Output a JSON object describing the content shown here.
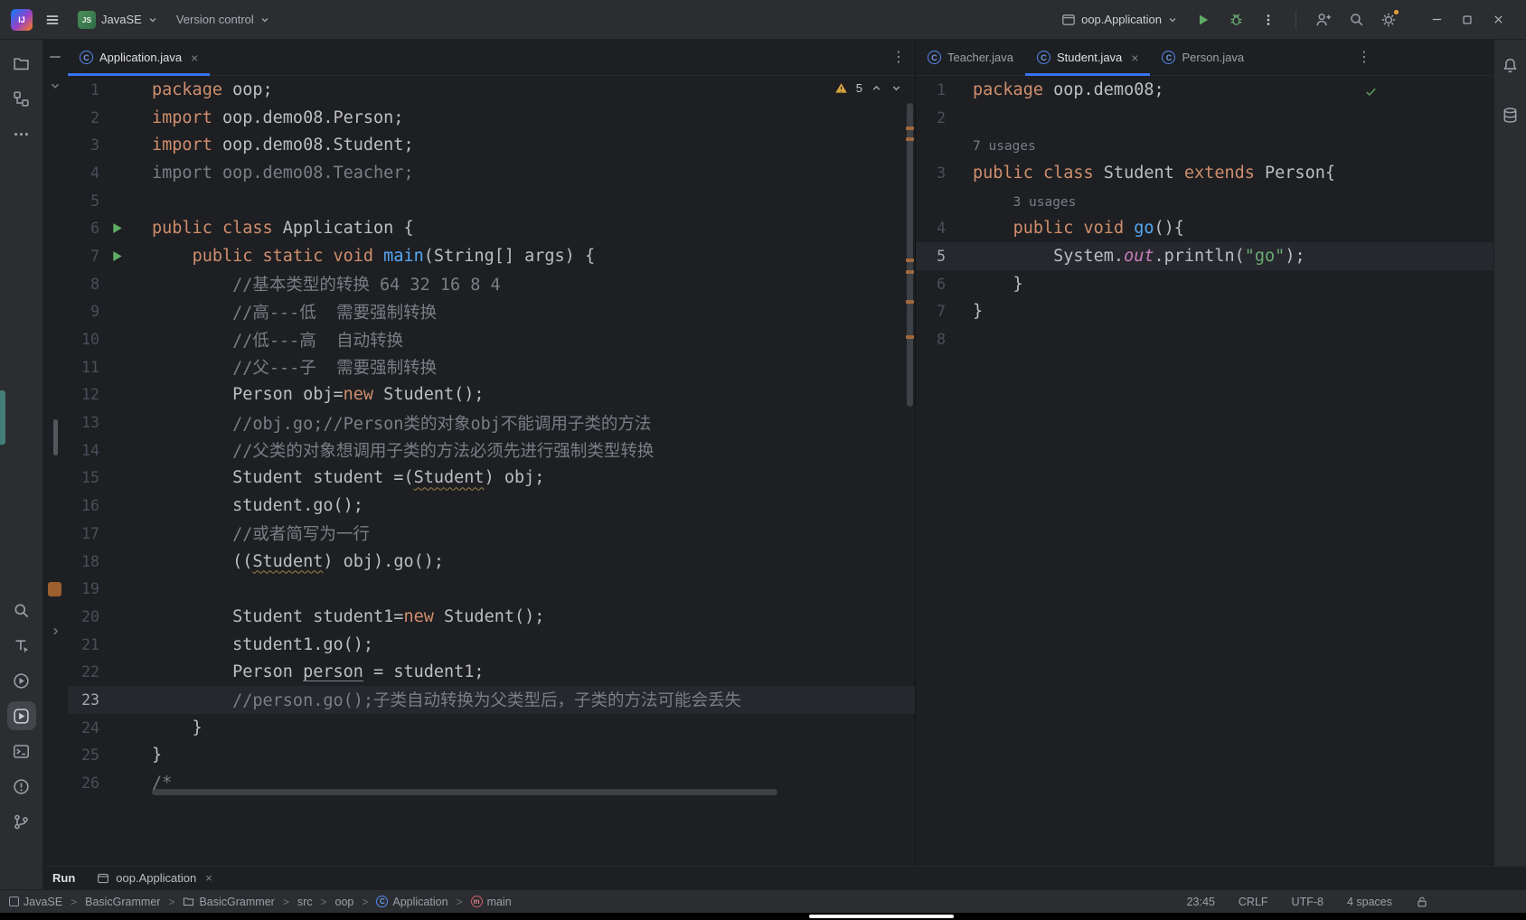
{
  "colors": {
    "accent": "#3574f0",
    "editor_bg": "#1e1f22",
    "panel_bg": "#2b2d30",
    "caret_line": "#26282e",
    "kw": "#cf8e6d",
    "plain": "#bcbec4",
    "comment": "#7a7e85",
    "method": "#56a8f5",
    "string": "#6aab73",
    "field": "#c77dbb",
    "run_green": "#5fad65",
    "warning": "#d9a440",
    "line_num": "#494f59"
  },
  "titlebar": {
    "logo": "IJ",
    "project_badge": "JS",
    "project_name": "JavaSE",
    "vcs_label": "Version control",
    "run_config": "oop.Application"
  },
  "left_stripe": {
    "top_icons": [
      "folder-icon",
      "structure-icon",
      "more-icon"
    ],
    "bottom_icons": [
      "search-icon",
      "find-icon",
      "services-icon",
      "run-icon",
      "terminal-icon",
      "problems-icon",
      "git-icon"
    ],
    "active_icon": "run-icon"
  },
  "right_stripe": {
    "icons": [
      "notifications-bell-icon",
      "database-icon"
    ]
  },
  "left_pane": {
    "tabs": [
      {
        "label": "Application.java",
        "active": true,
        "close": true
      }
    ],
    "warning_count": "5",
    "lines": [
      {
        "n": 1,
        "t": [
          [
            "kw",
            "package"
          ],
          [
            "pl",
            " oop;"
          ]
        ]
      },
      {
        "n": 2,
        "t": [
          [
            "kw",
            "import"
          ],
          [
            "pl",
            " oop.demo08.Person;"
          ]
        ]
      },
      {
        "n": 3,
        "t": [
          [
            "kw",
            "import"
          ],
          [
            "pl",
            " oop.demo08.Student;"
          ]
        ]
      },
      {
        "n": 4,
        "t": [
          [
            "gr",
            "import oop.demo08.Teacher;"
          ]
        ]
      },
      {
        "n": 5
      },
      {
        "n": 6,
        "run": true,
        "t": [
          [
            "kw",
            "public class"
          ],
          [
            "pl",
            " Application {"
          ]
        ]
      },
      {
        "n": 7,
        "run": true,
        "t": [
          [
            "pl",
            "    "
          ],
          [
            "kw",
            "public static void"
          ],
          [
            "fn",
            " main"
          ],
          [
            "pl",
            "(String[] args) {"
          ]
        ]
      },
      {
        "n": 8,
        "t": [
          [
            "cm",
            "        //基本类型的转换 64 32 16 8 4"
          ]
        ]
      },
      {
        "n": 9,
        "t": [
          [
            "cm",
            "        //高---低  需要强制转换"
          ]
        ]
      },
      {
        "n": 10,
        "t": [
          [
            "cm",
            "        //低---高  自动转换"
          ]
        ]
      },
      {
        "n": 11,
        "t": [
          [
            "cm",
            "        //父---子  需要强制转换"
          ]
        ]
      },
      {
        "n": 12,
        "t": [
          [
            "pl",
            "        Person obj="
          ],
          [
            "kw",
            "new"
          ],
          [
            "pl",
            " Student();"
          ]
        ]
      },
      {
        "n": 13,
        "t": [
          [
            "cm",
            "        //obj.go;//Person类的对象obj不能调用子类的方法"
          ]
        ]
      },
      {
        "n": 14,
        "t": [
          [
            "cm",
            "        //父类的对象想调用子类的方法必须先进行强制类型转换"
          ]
        ]
      },
      {
        "n": 15,
        "t": [
          [
            "pl",
            "        Student student =("
          ],
          [
            "uw",
            "Student"
          ],
          [
            "pl",
            ") obj;"
          ]
        ]
      },
      {
        "n": 16,
        "t": [
          [
            "pl",
            "        student.go();"
          ]
        ]
      },
      {
        "n": 17,
        "t": [
          [
            "cm",
            "        //或者简写为一行"
          ]
        ]
      },
      {
        "n": 18,
        "t": [
          [
            "pl",
            "        (("
          ],
          [
            "uw",
            "Student"
          ],
          [
            "pl",
            ") obj).go();"
          ]
        ]
      },
      {
        "n": 19
      },
      {
        "n": 20,
        "t": [
          [
            "pl",
            "        Student student1="
          ],
          [
            "kw",
            "new"
          ],
          [
            "pl",
            " Student();"
          ]
        ]
      },
      {
        "n": 21,
        "t": [
          [
            "pl",
            "        student1.go();"
          ]
        ]
      },
      {
        "n": 22,
        "t": [
          [
            "pl",
            "        Person "
          ],
          [
            "ug",
            "person"
          ],
          [
            "pl",
            " = student1;"
          ]
        ]
      },
      {
        "n": 23,
        "hl": true,
        "t": [
          [
            "cm",
            "        //person.go();子类自动转换为父类型后，子类的方法可能会丢失"
          ]
        ]
      },
      {
        "n": 24,
        "t": [
          [
            "pl",
            "    }"
          ]
        ]
      },
      {
        "n": 25,
        "t": [
          [
            "pl",
            "}"
          ]
        ]
      },
      {
        "n": 26,
        "t": [
          [
            "cm",
            "/*"
          ]
        ]
      }
    ]
  },
  "right_pane": {
    "tabs": [
      {
        "label": "Teacher.java"
      },
      {
        "label": "Student.java",
        "active": true,
        "close": true
      },
      {
        "label": "Person.java"
      }
    ],
    "lines": [
      {
        "n": 1,
        "t": [
          [
            "kw",
            "package"
          ],
          [
            "pl",
            " oop.demo08;"
          ]
        ]
      },
      {
        "n": 2
      },
      {
        "inlay": "7 usages",
        "pad": 0
      },
      {
        "n": 3,
        "t": [
          [
            "kw",
            "public class"
          ],
          [
            "pl",
            " Student "
          ],
          [
            "kw",
            "extends"
          ],
          [
            "pl",
            " Person{"
          ]
        ]
      },
      {
        "inlay": "3 usages",
        "pad": 4
      },
      {
        "n": 4,
        "t": [
          [
            "pl",
            "    "
          ],
          [
            "kw",
            "public void"
          ],
          [
            "fn",
            " go"
          ],
          [
            "pl",
            "(){"
          ]
        ]
      },
      {
        "n": 5,
        "hl": true,
        "t": [
          [
            "pl",
            "        System."
          ],
          [
            "sf",
            "out"
          ],
          [
            "pl",
            ".println("
          ],
          [
            "str",
            "\"go\""
          ],
          [
            "pl",
            ");"
          ]
        ]
      },
      {
        "n": 6,
        "t": [
          [
            "pl",
            "    }"
          ]
        ]
      },
      {
        "n": 7,
        "t": [
          [
            "pl",
            "}"
          ]
        ]
      },
      {
        "n": 8
      }
    ]
  },
  "runbar": {
    "title": "Run",
    "tab_label": "oop.Application"
  },
  "statusbar": {
    "breadcrumbs": [
      {
        "label": "JavaSE",
        "icon": "module"
      },
      {
        "label": "BasicGrammer"
      },
      {
        "label": "BasicGrammer",
        "icon": "folder"
      },
      {
        "label": "src"
      },
      {
        "label": "oop"
      },
      {
        "label": "Application",
        "icon": "class"
      },
      {
        "label": "main",
        "icon": "method"
      }
    ],
    "time": "23:45",
    "line_ending": "CRLF",
    "encoding": "UTF-8",
    "indent": "4 spaces"
  }
}
